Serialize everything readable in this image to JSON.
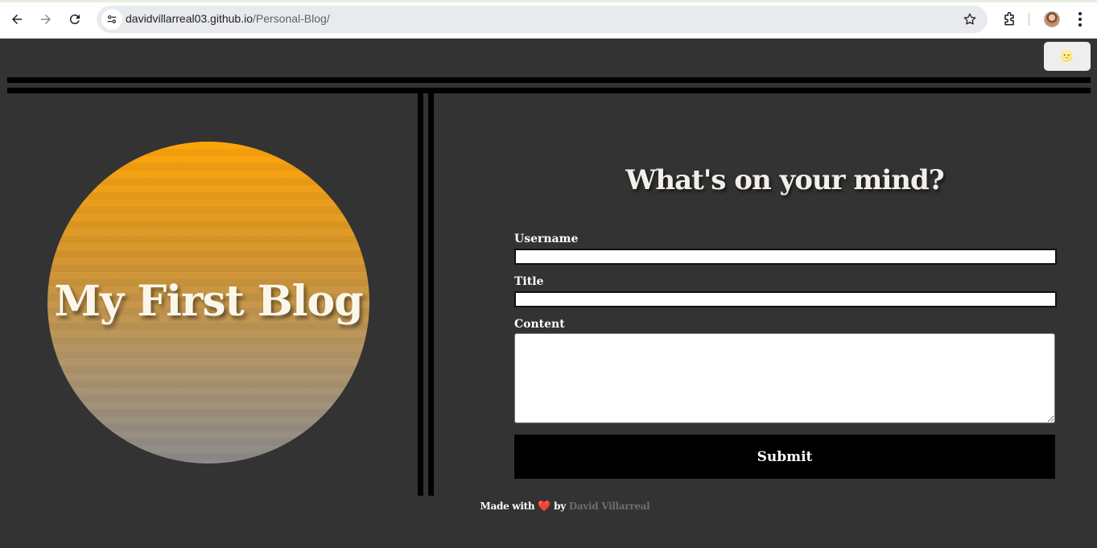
{
  "browser": {
    "url_domain": "davidvillarreal03.github.io",
    "url_path": "/Personal-Blog/",
    "icons": [
      "back-icon",
      "forward-icon",
      "reload-icon",
      "site-info-icon",
      "bookmark-star-icon",
      "extensions-icon",
      "profile-avatar",
      "more-menu-icon"
    ]
  },
  "theme_toggle": {
    "label": "🌝"
  },
  "hero": {
    "title": "My First Blog"
  },
  "form": {
    "heading": "What's on your mind?",
    "username_label": "Username",
    "username_value": "",
    "title_label": "Title",
    "title_value": "",
    "content_label": "Content",
    "content_value": "",
    "submit_label": "Submit"
  },
  "footer": {
    "made_with": "Made with",
    "heart": "❤️",
    "by": "by",
    "author": "David Villarreal"
  },
  "colors": {
    "page_bg": "#333333",
    "circle_top": "#ffa50a",
    "circle_bottom": "#8c8c8c",
    "submit_bg": "#000000"
  }
}
